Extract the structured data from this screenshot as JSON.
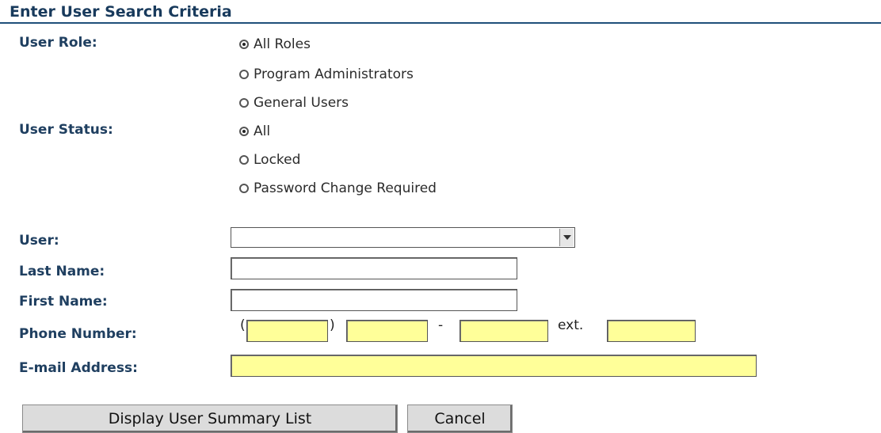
{
  "header": {
    "title": "Enter User Search Criteria"
  },
  "user_role": {
    "label": "User Role:",
    "options": [
      {
        "label": "All Roles",
        "selected": true
      },
      {
        "label": "Program Administrators",
        "selected": false
      },
      {
        "label": "General Users",
        "selected": false
      }
    ]
  },
  "user_status": {
    "label": "User Status:",
    "options": [
      {
        "label": "All",
        "selected": true
      },
      {
        "label": "Locked",
        "selected": false
      },
      {
        "label": "Password Change Required",
        "selected": false
      }
    ]
  },
  "user": {
    "label": "User:",
    "value": ""
  },
  "last_name": {
    "label": "Last Name:",
    "value": ""
  },
  "first_name": {
    "label": "First Name:",
    "value": ""
  },
  "phone": {
    "label": "Phone Number:",
    "open_paren": "(",
    "close_paren": ")",
    "dash": "-",
    "ext_label": "ext.",
    "area": "",
    "prefix": "",
    "line": "",
    "ext": ""
  },
  "email": {
    "label": "E-mail Address:",
    "value": ""
  },
  "buttons": {
    "display": "Display User Summary List",
    "cancel": "Cancel"
  },
  "colors": {
    "header_rule": "#1f4f7a",
    "field_highlight": "#ffff99"
  }
}
